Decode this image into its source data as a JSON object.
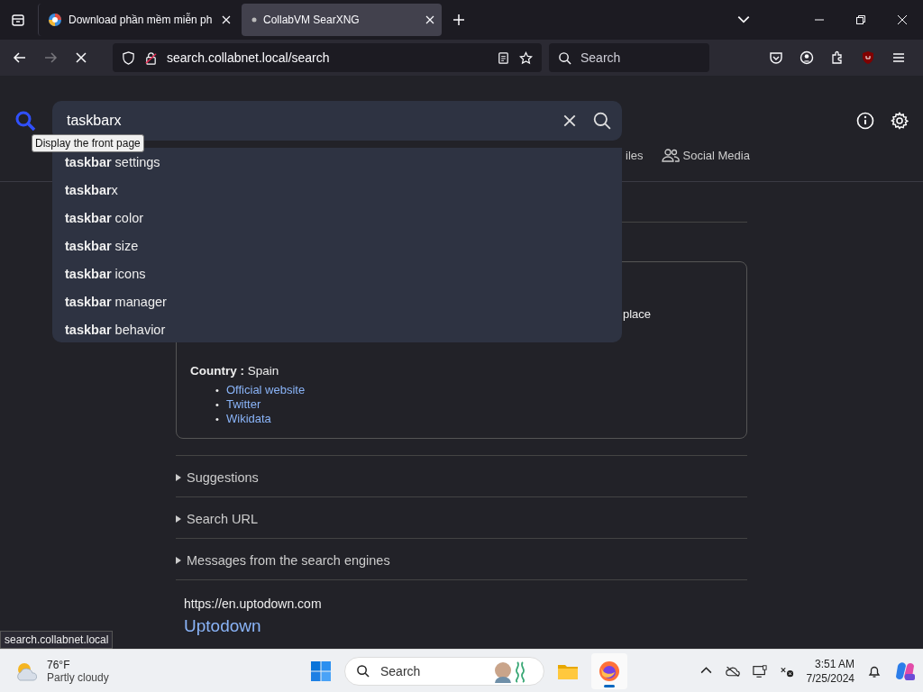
{
  "browser": {
    "tabs": [
      {
        "title": "Download phần mềm miễn ph",
        "selected": false,
        "kind": "colorful"
      },
      {
        "title": "CollabVM SearXNG",
        "selected": true,
        "kind": "dot"
      }
    ],
    "address": "search.collabnet.local/search",
    "search_placeholder": "Search"
  },
  "page": {
    "query": "taskbarx",
    "tooltip": "Display the front page",
    "suggestions": [
      "**taskbar** settings",
      "**taskbar**x",
      "**taskbar** color",
      "**taskbar** size",
      "**taskbar** icons",
      "**taskbar** manager",
      "**taskbar** behavior"
    ],
    "categories": [
      {
        "label": "iles",
        "kind": "files"
      },
      {
        "label": "Social Media",
        "kind": "social"
      }
    ],
    "infobox": {
      "trailing_text": "place",
      "country_label": "Country :",
      "country_value": "Spain",
      "bullet": "•",
      "links": [
        "Official website",
        "Twitter",
        "Wikidata"
      ]
    },
    "sections": [
      {
        "label": "Suggestions",
        "expanded": false
      },
      {
        "label": "Search URL",
        "expanded": false
      },
      {
        "label": "Messages from the search engines",
        "expanded": false
      }
    ],
    "result": {
      "url": "https://en.uptodown.com",
      "title": "Uptodown"
    },
    "status_url": "search.collabnet.local"
  },
  "taskbar": {
    "temperature": "76°F",
    "weather": "Partly cloudy",
    "search_placeholder": "Search",
    "time": "3:51 AM",
    "date": "7/25/2024"
  }
}
